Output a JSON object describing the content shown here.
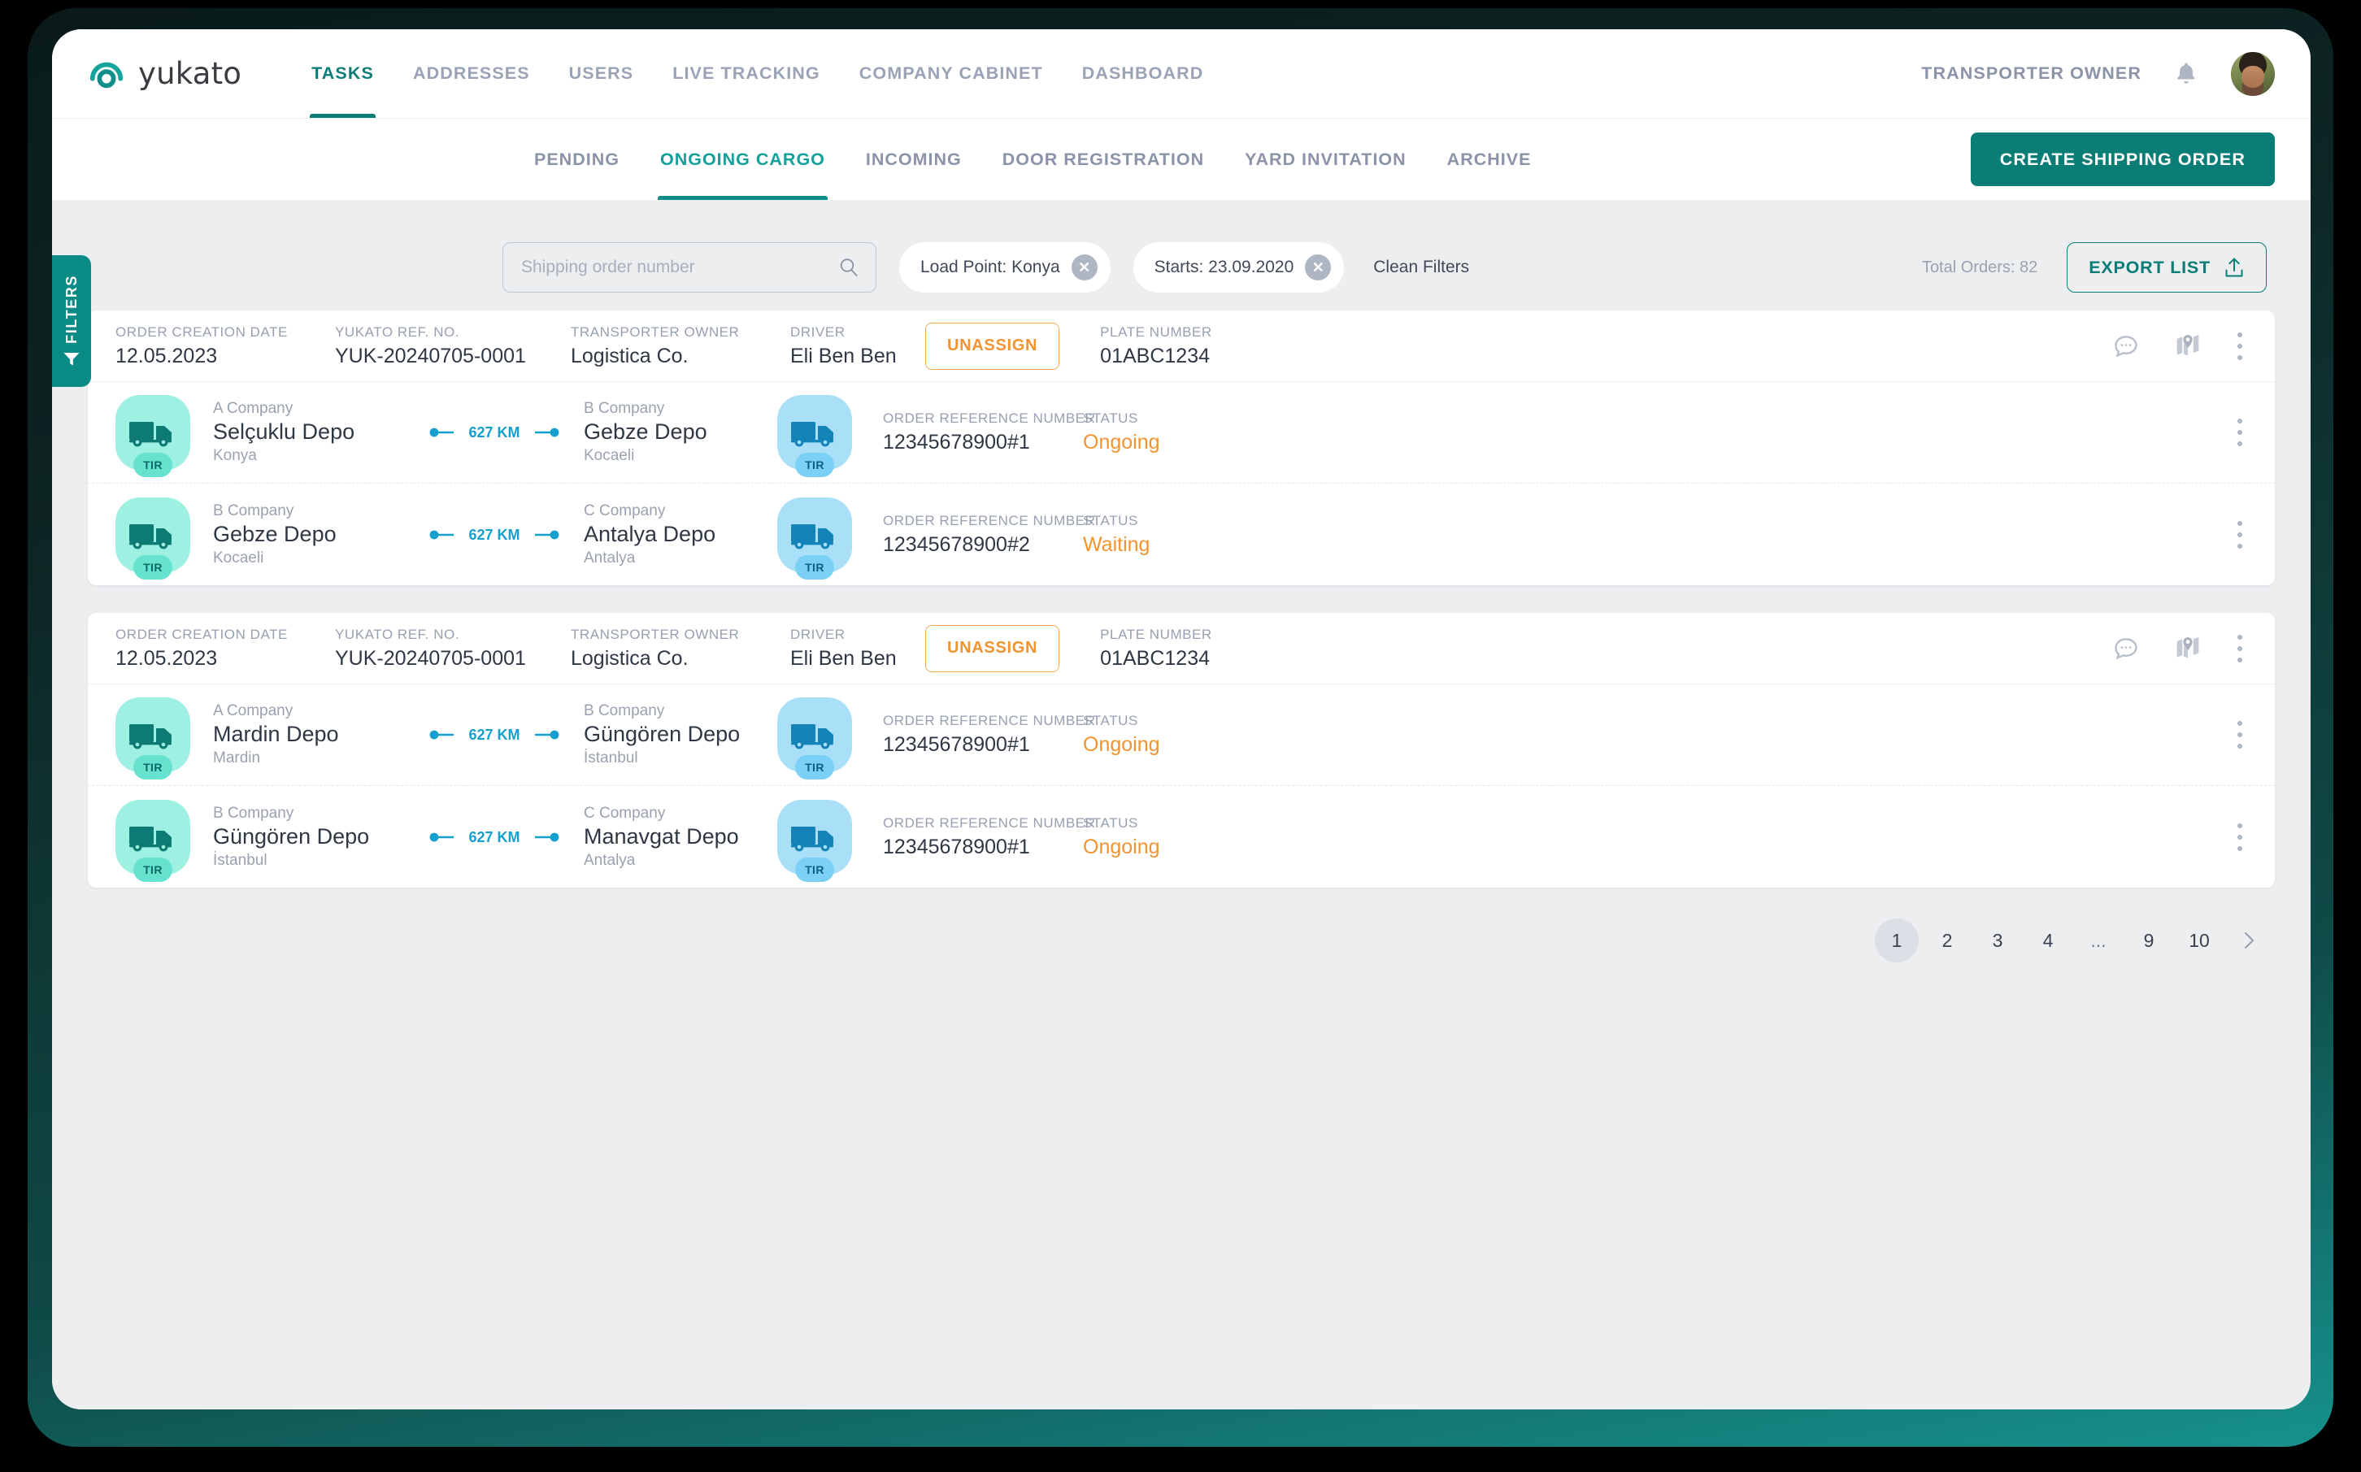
{
  "brand": {
    "name": "yukato",
    "logo_icon": "yukato-ring-logo",
    "accent": "#0b7d77"
  },
  "topnav": {
    "items": [
      {
        "label": "TASKS",
        "active": true
      },
      {
        "label": "ADDRESSES",
        "active": false
      },
      {
        "label": "USERS",
        "active": false
      },
      {
        "label": "LIVE TRACKING",
        "active": false
      },
      {
        "label": "COMPANY CABINET",
        "active": false
      },
      {
        "label": "DASHBOARD",
        "active": false
      }
    ],
    "user_role": "TRANSPORTER OWNER",
    "bell_icon": "notification-bell-icon",
    "avatar_icon": "user-avatar"
  },
  "subnav": {
    "items": [
      {
        "label": "PENDING",
        "active": false
      },
      {
        "label": "ONGOING CARGO",
        "active": true
      },
      {
        "label": "INCOMING",
        "active": false
      },
      {
        "label": "DOOR REGISTRATION",
        "active": false
      },
      {
        "label": "YARD INVITATION",
        "active": false
      },
      {
        "label": "ARCHIVE",
        "active": false
      }
    ],
    "create_button": "CREATE SHIPPING ORDER"
  },
  "filters_tab": {
    "label": "FILTERS",
    "icon": "funnel-icon"
  },
  "filterbar": {
    "search": {
      "placeholder": "Shipping order number",
      "value": "",
      "icon": "search-icon"
    },
    "chips": [
      {
        "label": "Load Point: Konya",
        "remove_icon": "close-circle-icon"
      },
      {
        "label": "Starts: 23.09.2020",
        "remove_icon": "close-circle-icon"
      }
    ],
    "clean_filters": "Clean Filters",
    "total_orders": "Total Orders: 82",
    "export_button": "EXPORT LIST",
    "export_icon": "upload-icon"
  },
  "labels": {
    "order_creation_date": "ORDER CREATION DATE",
    "yukato_ref_no": "YUKATO REF. NO.",
    "transporter_owner": "TRANSPORTER OWNER",
    "driver": "DRIVER",
    "plate_number": "PLATE NUMBER",
    "order_reference_number": "ORDER REFERENCE NUMBER",
    "status": "STATUS",
    "unassign": "UNASSIGN",
    "distance_unit": "KM"
  },
  "orders": [
    {
      "creation_date": "12.05.2023",
      "yukato_ref": "YUK-20240705-0001",
      "transporter_owner": "Logistica Co.",
      "driver": "Eli Ben Ben",
      "plate_number": "01ABC1234",
      "chat_icon": "chat-bubble-icon",
      "map_icon": "map-pin-icon",
      "menu_icon": "kebab-menu-icon",
      "legs": [
        {
          "from_company": "A Company",
          "from_depot": "Selçuklu Depo",
          "from_city": "Konya",
          "to_company": "B Company",
          "to_depot": "Gebze Depo",
          "to_city": "Kocaeli",
          "distance": "627 KM",
          "order_reference": "12345678900#1",
          "status": "Ongoing",
          "status_color": "#f2932f",
          "vehicle_badge": "TIR"
        },
        {
          "from_company": "B Company",
          "from_depot": "Gebze Depo",
          "from_city": "Kocaeli",
          "to_company": "C Company",
          "to_depot": "Antalya Depo",
          "to_city": "Antalya",
          "distance": "627 KM",
          "order_reference": "12345678900#2",
          "status": "Waiting",
          "status_color": "#f2932f",
          "vehicle_badge": "TIR"
        }
      ]
    },
    {
      "creation_date": "12.05.2023",
      "yukato_ref": "YUK-20240705-0001",
      "transporter_owner": "Logistica Co.",
      "driver": "Eli Ben Ben",
      "plate_number": "01ABC1234",
      "chat_icon": "chat-bubble-icon",
      "map_icon": "map-pin-icon",
      "menu_icon": "kebab-menu-icon",
      "legs": [
        {
          "from_company": "A Company",
          "from_depot": "Mardin Depo",
          "from_city": "Mardin",
          "to_company": "B Company",
          "to_depot": "Güngören Depo",
          "to_city": "İstanbul",
          "distance": "627 KM",
          "order_reference": "12345678900#1",
          "status": "Ongoing",
          "status_color": "#f2932f",
          "vehicle_badge": "TIR"
        },
        {
          "from_company": "B Company",
          "from_depot": "Güngören Depo",
          "from_city": "İstanbul",
          "to_company": "C Company",
          "to_depot": "Manavgat Depo",
          "to_city": "Antalya",
          "distance": "627 KM",
          "order_reference": "12345678900#1",
          "status": "Ongoing",
          "status_color": "#f2932f",
          "vehicle_badge": "TIR"
        }
      ]
    }
  ],
  "pagination": {
    "pages": [
      "1",
      "2",
      "3",
      "4",
      "...",
      "9",
      "10"
    ],
    "current": "1",
    "next_icon": "chevron-right-icon"
  }
}
